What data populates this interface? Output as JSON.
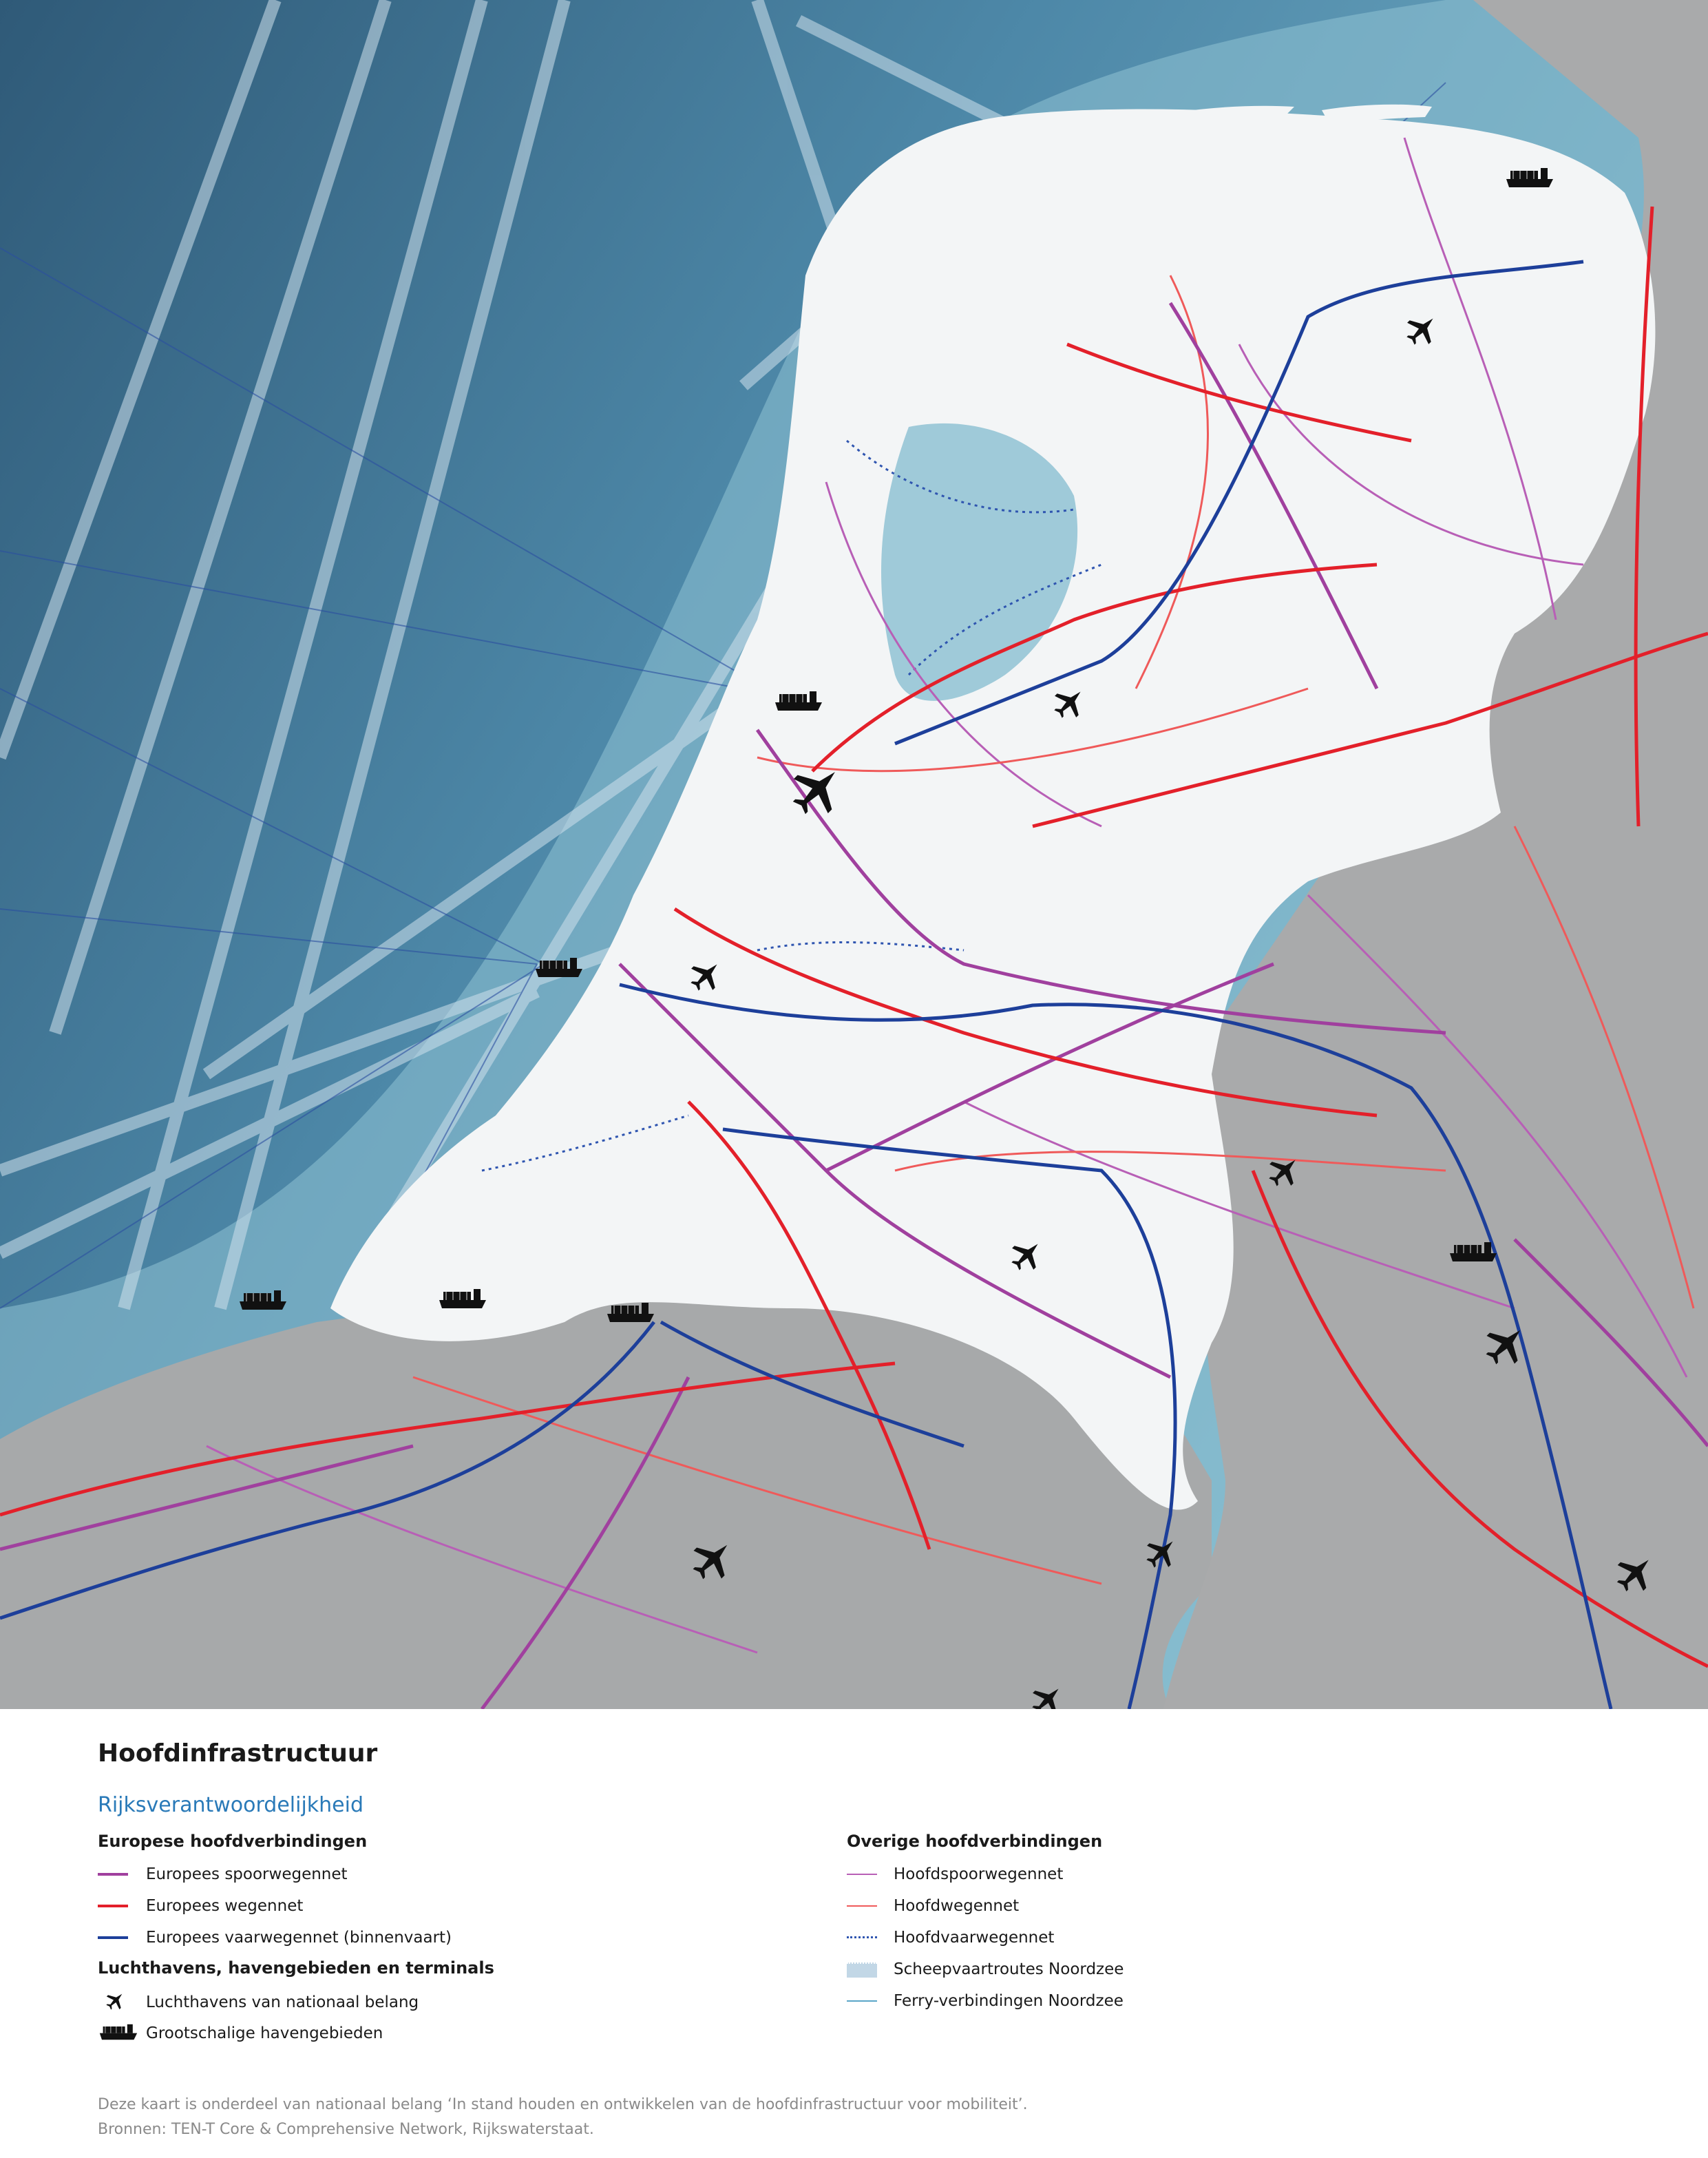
{
  "legend": {
    "title": "Hoofdinfrastructuur",
    "subtitle": "Rijksverantwoordelijkheid",
    "left_groups": [
      {
        "heading": "Europese hoofdverbindingen",
        "items": [
          {
            "label": "Europees spoorwegennet",
            "symbol": "line",
            "color": "#a0409e"
          },
          {
            "label": "Europees wegennet",
            "symbol": "line",
            "color": "#e3202a"
          },
          {
            "label": "Europees vaarwegennet (binnenvaart)",
            "symbol": "line",
            "color": "#1d3f9a"
          }
        ]
      },
      {
        "heading": "Luchthavens, havengebieden en terminals",
        "items": [
          {
            "label": "Luchthavens van nationaal belang",
            "symbol": "airplane-icon"
          },
          {
            "label": "Grootschalige havengebieden",
            "symbol": "ship-icon"
          }
        ]
      }
    ],
    "right_groups": [
      {
        "heading": "Overige hoofdverbindingen",
        "items": [
          {
            "label": "Hoofdspoorwegennet",
            "symbol": "line-thin",
            "color": "#b85fb6"
          },
          {
            "label": "Hoofdwegennet",
            "symbol": "line-thin",
            "color": "#ef5a5a"
          },
          {
            "label": "Hoofdvaarwegennet",
            "symbol": "dotted",
            "color": "#2f55b0"
          },
          {
            "label": "Scheepvaartroutes Noordzee",
            "symbol": "band",
            "color": "#c2d7e6"
          },
          {
            "label": "Ferry-verbindingen Noordzee",
            "symbol": "line-thin",
            "color": "#5aa6c8"
          }
        ]
      }
    ],
    "footnote_1": "Deze kaart is onderdeel van nationaal belang ‘In stand houden en ontwikkelen van de hoofdinfrastructuur voor mobiliteit’.",
    "footnote_2": "Bronnen: TEN-T Core & Comprehensive Network, Rijkswaterstaat."
  },
  "map": {
    "colors": {
      "sea_deep": "#3c6b8a",
      "sea_shallow": "#9cc9d8",
      "land_nl": "#f4f6f7",
      "land_abroad": "#a9aaab",
      "europees_spoor": "#a0409e",
      "europees_weg": "#e3202a",
      "europees_vaarweg": "#1d3f9a",
      "hoofdvaarweg": "#2f55b0",
      "shipping_lanes": "#c8dbe6"
    },
    "airports_count_icons": [
      "airplane-icon"
    ],
    "ports_icons": [
      "ship-icon"
    ]
  }
}
